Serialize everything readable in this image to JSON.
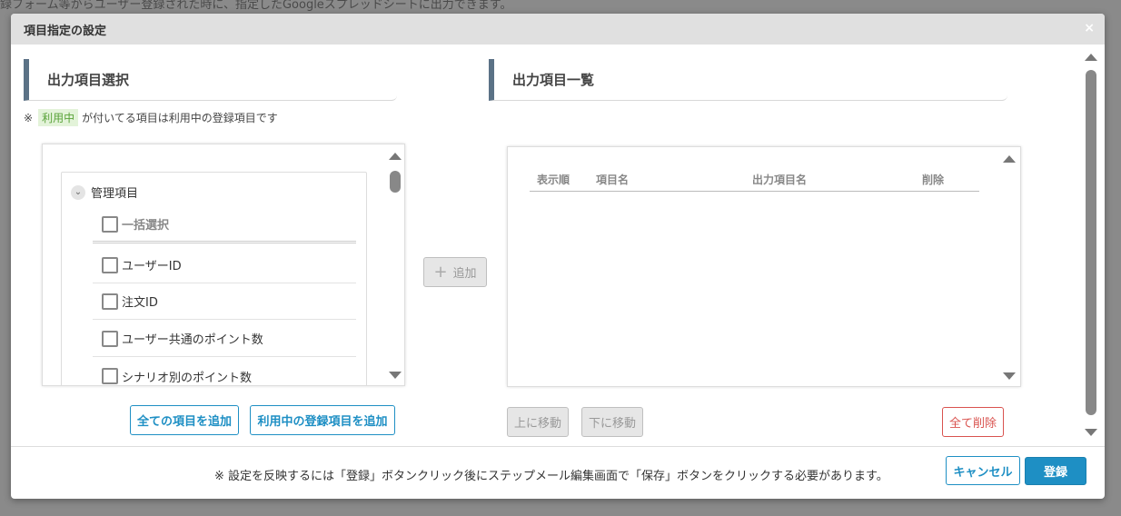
{
  "backdrop": {
    "top_text": "録フォーム等からユーザー登録された時に、指定したGoogleスプレッドシートに出力できます。"
  },
  "modal": {
    "title": "項目指定の設定",
    "close_glyph": "×"
  },
  "left": {
    "section_title": "出力項目選択",
    "note_prefix": "※",
    "note_badge": "利用中",
    "note_suffix": "が付いてる項目は利用中の登録項目です",
    "group_label": "管理項目",
    "select_all_label": "一括選択",
    "items": [
      "ユーザーID",
      "注文ID",
      "ユーザー共通のポイント数",
      "シナリオ別のポイント数"
    ],
    "add_all_button": "全ての項目を追加",
    "add_used_button": "利用中の登録項目を追加"
  },
  "middle": {
    "add_button": "追加",
    "add_icon": "plus-icon"
  },
  "right": {
    "section_title": "出力項目一覧",
    "columns": [
      "表示順",
      "項目名",
      "出力項目名",
      "削除"
    ],
    "rows": [],
    "move_up_button": "上に移動",
    "move_down_button": "下に移動",
    "delete_all_button": "全て削除"
  },
  "footer": {
    "note": "※ 設定を反映するには「登録」ボタンクリック後にステップメール編集画面で「保存」ボタンをクリックする必要があります。",
    "cancel_button": "キャンセル",
    "submit_button": "登録"
  },
  "colors": {
    "accent": "#1e8fc4",
    "section_bar": "#5b7286",
    "danger": "#d9534f",
    "badge_bg": "#e3f3d9",
    "badge_text": "#5aa33a"
  }
}
